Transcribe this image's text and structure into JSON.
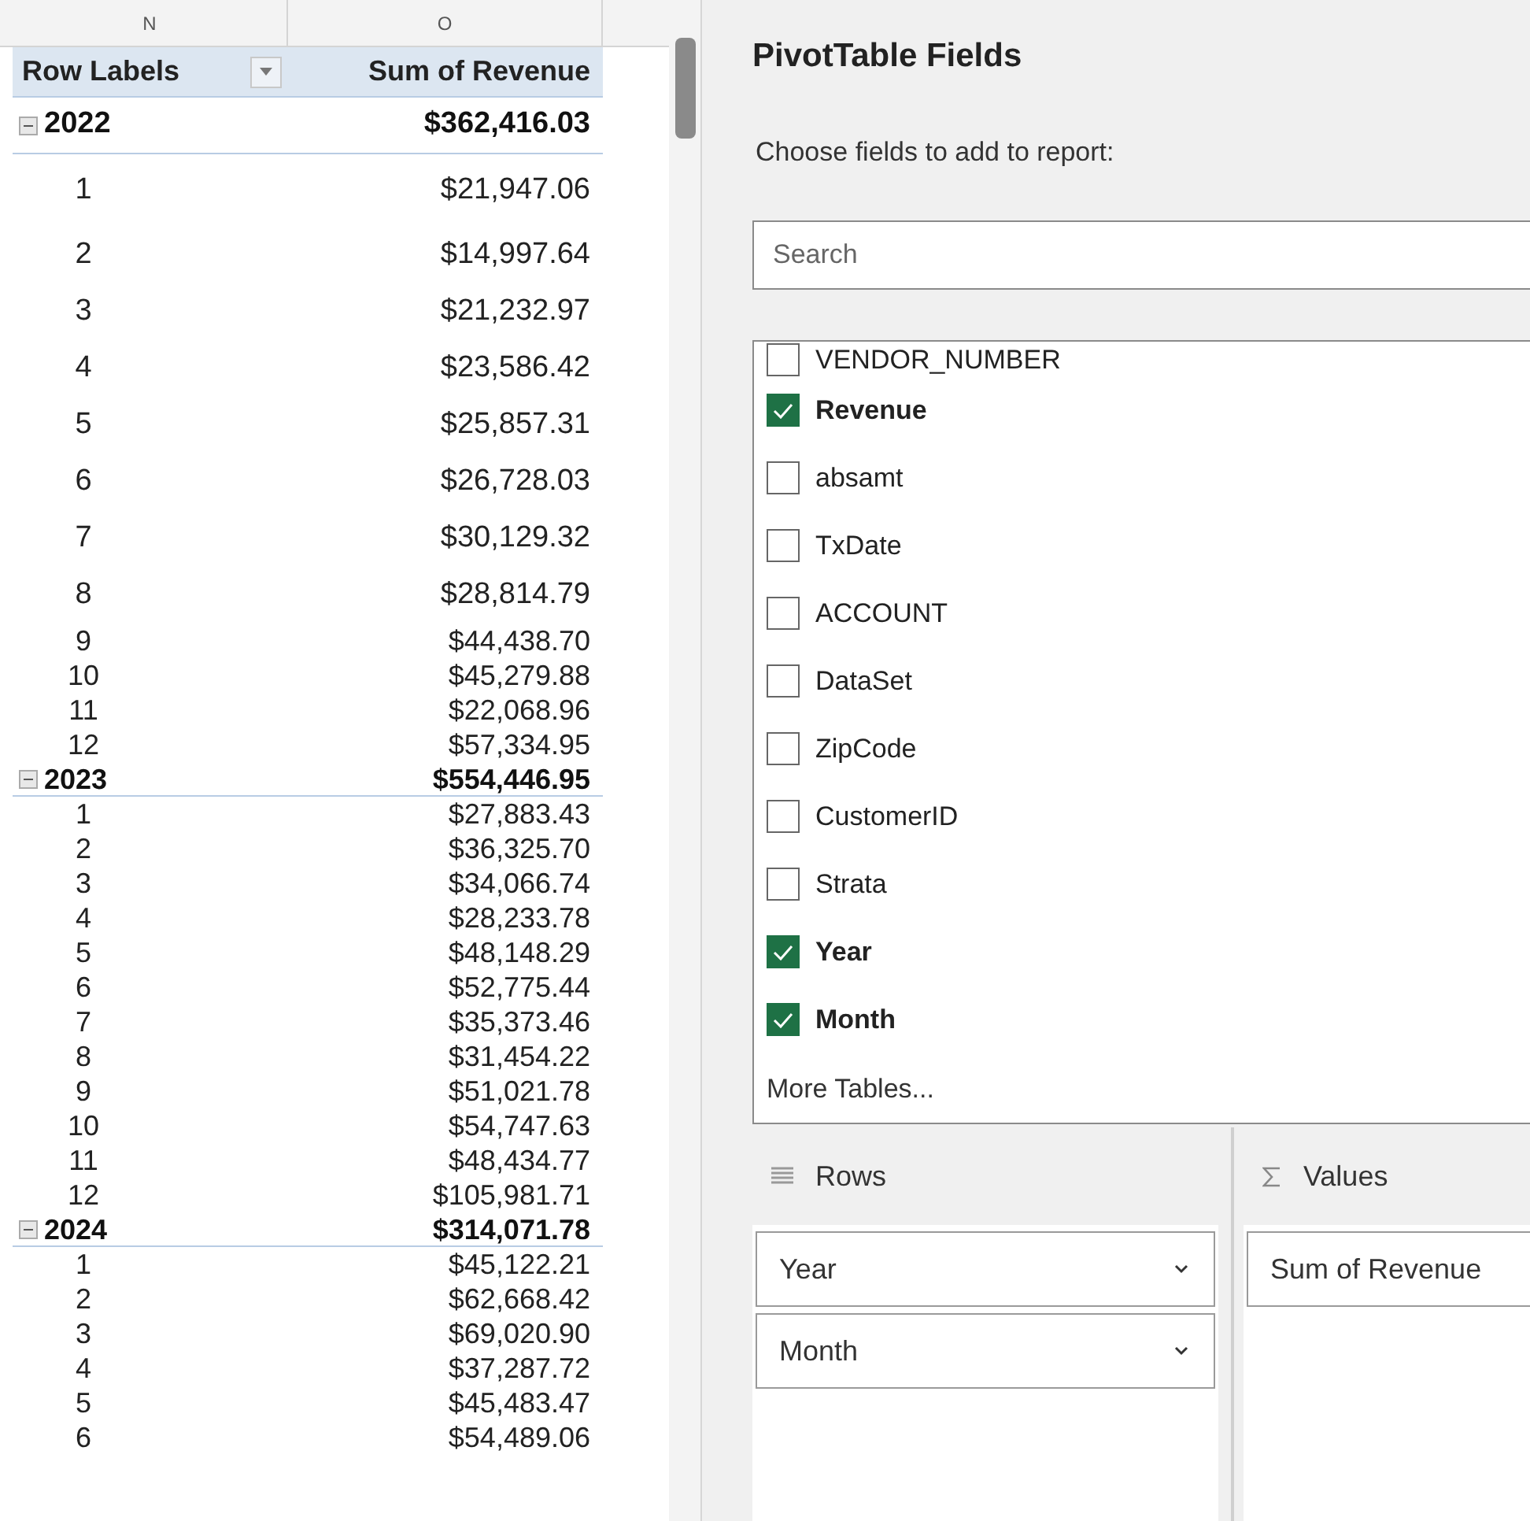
{
  "sheet": {
    "column_headers": [
      "N",
      "O"
    ],
    "pivot": {
      "columns": [
        "Row Labels",
        "Sum of Revenue"
      ],
      "rows": [
        {
          "kind": "year",
          "label": "2022",
          "value": "$362,416.03",
          "expanded": true
        },
        {
          "kind": "month",
          "label": "1",
          "value": "$21,947.06"
        },
        {
          "kind": "month",
          "label": "2",
          "value": "$14,997.64"
        },
        {
          "kind": "month",
          "label": "3",
          "value": "$21,232.97"
        },
        {
          "kind": "month",
          "label": "4",
          "value": "$23,586.42"
        },
        {
          "kind": "month",
          "label": "5",
          "value": "$25,857.31"
        },
        {
          "kind": "month",
          "label": "6",
          "value": "$26,728.03"
        },
        {
          "kind": "month",
          "label": "7",
          "value": "$30,129.32"
        },
        {
          "kind": "month",
          "label": "8",
          "value": "$28,814.79"
        },
        {
          "kind": "month",
          "label": "9",
          "value": "$44,438.70"
        },
        {
          "kind": "month",
          "label": "10",
          "value": "$45,279.88"
        },
        {
          "kind": "month",
          "label": "11",
          "value": "$22,068.96"
        },
        {
          "kind": "month",
          "label": "12",
          "value": "$57,334.95"
        },
        {
          "kind": "year",
          "label": "2023",
          "value": "$554,446.95",
          "expanded": true
        },
        {
          "kind": "month",
          "label": "1",
          "value": "$27,883.43"
        },
        {
          "kind": "month",
          "label": "2",
          "value": "$36,325.70"
        },
        {
          "kind": "month",
          "label": "3",
          "value": "$34,066.74"
        },
        {
          "kind": "month",
          "label": "4",
          "value": "$28,233.78"
        },
        {
          "kind": "month",
          "label": "5",
          "value": "$48,148.29"
        },
        {
          "kind": "month",
          "label": "6",
          "value": "$52,775.44"
        },
        {
          "kind": "month",
          "label": "7",
          "value": "$35,373.46"
        },
        {
          "kind": "month",
          "label": "8",
          "value": "$31,454.22"
        },
        {
          "kind": "month",
          "label": "9",
          "value": "$51,021.78"
        },
        {
          "kind": "month",
          "label": "10",
          "value": "$54,747.63"
        },
        {
          "kind": "month",
          "label": "11",
          "value": "$48,434.77"
        },
        {
          "kind": "month",
          "label": "12",
          "value": "$105,981.71"
        },
        {
          "kind": "year",
          "label": "2024",
          "value": "$314,071.78",
          "expanded": true
        },
        {
          "kind": "month",
          "label": "1",
          "value": "$45,122.21"
        },
        {
          "kind": "month",
          "label": "2",
          "value": "$62,668.42"
        },
        {
          "kind": "month",
          "label": "3",
          "value": "$69,020.90"
        },
        {
          "kind": "month",
          "label": "4",
          "value": "$37,287.72"
        },
        {
          "kind": "month",
          "label": "5",
          "value": "$45,483.47"
        },
        {
          "kind": "month",
          "label": "6",
          "value": "$54,489.06"
        }
      ]
    }
  },
  "panel": {
    "title": "PivotTable Fields",
    "subtitle": "Choose fields to add to report:",
    "search": {
      "placeholder": "Search"
    },
    "fields": [
      {
        "label": "VENDOR_NUMBER",
        "checked": false
      },
      {
        "label": "Revenue",
        "checked": true
      },
      {
        "label": "absamt",
        "checked": false
      },
      {
        "label": "TxDate",
        "checked": false
      },
      {
        "label": "ACCOUNT",
        "checked": false
      },
      {
        "label": "DataSet",
        "checked": false
      },
      {
        "label": "ZipCode",
        "checked": false
      },
      {
        "label": "CustomerID",
        "checked": false
      },
      {
        "label": "Strata",
        "checked": false
      },
      {
        "label": "Year",
        "checked": true
      },
      {
        "label": "Month",
        "checked": true
      }
    ],
    "more_tables": "More Tables...",
    "areas": [
      {
        "kind": "rows",
        "title": "Rows",
        "fields": [
          {
            "label": "Year"
          },
          {
            "label": "Month"
          }
        ]
      },
      {
        "kind": "values",
        "title": "Values",
        "fields": [
          {
            "label": "Sum of Revenue"
          }
        ]
      }
    ]
  }
}
